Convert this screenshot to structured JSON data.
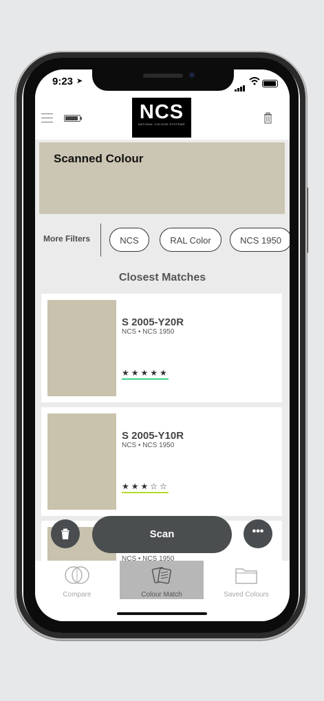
{
  "status_bar": {
    "time": "9:23"
  },
  "header": {
    "logo_text": "NCS",
    "logo_subtext": "NATURAL COLOUR SYSTEM®"
  },
  "scanned": {
    "title": "Scanned Colour",
    "color": "#cbc5b4"
  },
  "filters": {
    "label": "More Filters",
    "chips": [
      "NCS",
      "RAL Color",
      "NCS 1950"
    ]
  },
  "matches": {
    "heading": "Closest Matches",
    "items": [
      {
        "code": "S 2005-Y20R",
        "systems": "NCS • NCS 1950",
        "rating": 5,
        "stars": "★★★★★",
        "swatch": "#c8c2ae",
        "accent": "#3fd08a"
      },
      {
        "code": "S 2005-Y10R",
        "systems": "NCS • NCS 1950",
        "rating": 3,
        "stars": "★★★☆☆",
        "swatch": "#c9c3ac",
        "accent": "#b4d82a"
      },
      {
        "code": "",
        "systems": "NCS • NCS 1950",
        "swatch": "#c8c2ae"
      }
    ]
  },
  "actions": {
    "scan_label": "Scan"
  },
  "tabs": [
    {
      "label": "Compare",
      "icon": "compare-icon"
    },
    {
      "label": "Colour Match",
      "icon": "colour-match-icon",
      "active": true
    },
    {
      "label": "Saved Colours",
      "icon": "folder-icon"
    }
  ]
}
